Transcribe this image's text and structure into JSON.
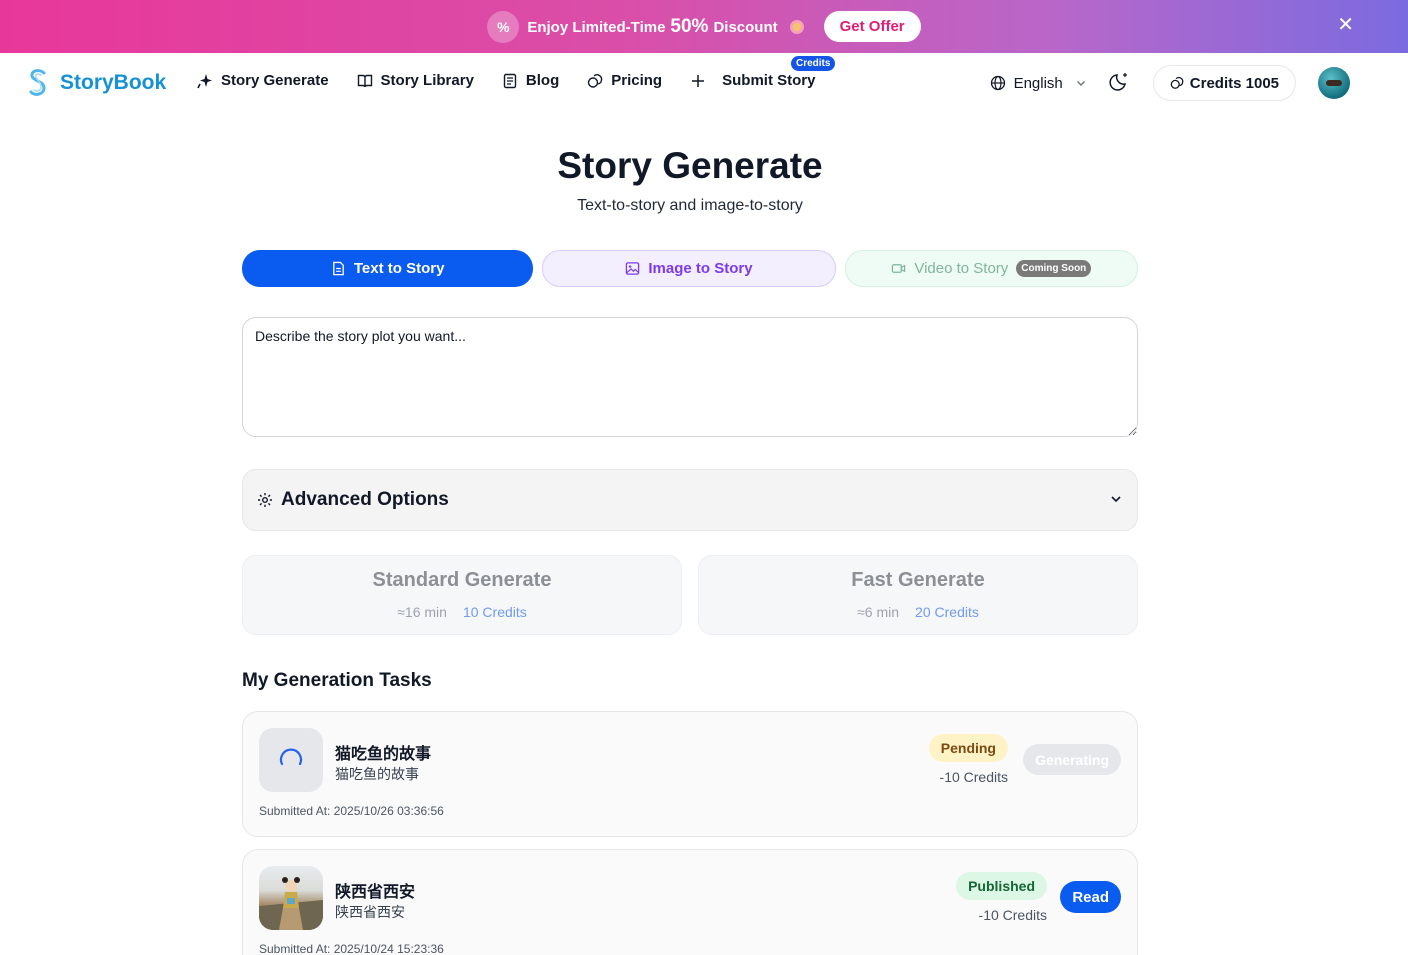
{
  "promo": {
    "text_prefix": "Enjoy Limited-Time",
    "percent": "50%",
    "text_suffix": "Discount",
    "cta": "Get Offer",
    "percent_glyph": "%",
    "close_glyph": "✕"
  },
  "brand": {
    "name": "StoryBook",
    "color": "#1592d6"
  },
  "nav": {
    "items": [
      {
        "label": "Story Generate",
        "icon": "sparkle-icon"
      },
      {
        "label": "Story Library",
        "icon": "book-open-icon"
      },
      {
        "label": "Blog",
        "icon": "document-icon"
      },
      {
        "label": "Pricing",
        "icon": "coins-icon"
      },
      {
        "label": "Submit Story",
        "icon": "plus-icon",
        "badge": "Credits"
      }
    ],
    "language": "English",
    "credits_label": "Credits 1005"
  },
  "page": {
    "title": "Story Generate",
    "subtitle": "Text-to-story and image-to-story"
  },
  "tabs": [
    {
      "label": "Text to Story",
      "active": true
    },
    {
      "label": "Image to Story"
    },
    {
      "label": "Video to Story",
      "badge": "Coming Soon"
    }
  ],
  "prompt": {
    "placeholder": "Describe the story plot you want..."
  },
  "advanced": {
    "label": "Advanced Options"
  },
  "generate": [
    {
      "title": "Standard Generate",
      "time": "≈16 min",
      "credits": "10 Credits"
    },
    {
      "title": "Fast Generate",
      "time": "≈6 min",
      "credits": "20 Credits"
    }
  ],
  "tasks_title": "My Generation Tasks",
  "tasks": [
    {
      "name": "猫吃鱼的故事",
      "subtitle": "猫吃鱼的故事",
      "status": "Pending",
      "cost": "-10 Credits",
      "action": "Generating",
      "submitted": "Submitted At: 2025/10/26 03:36:56"
    },
    {
      "name": "陕西省西安",
      "subtitle": "陕西省西安",
      "status": "Published",
      "cost": "-10 Credits",
      "action": "Read",
      "submitted": "Submitted At: 2025/10/24 15:23:36"
    }
  ],
  "colors": {
    "primary": "#0a5bef",
    "pending_bg": "#fdf3c7",
    "published_bg": "#dcf7e6"
  }
}
